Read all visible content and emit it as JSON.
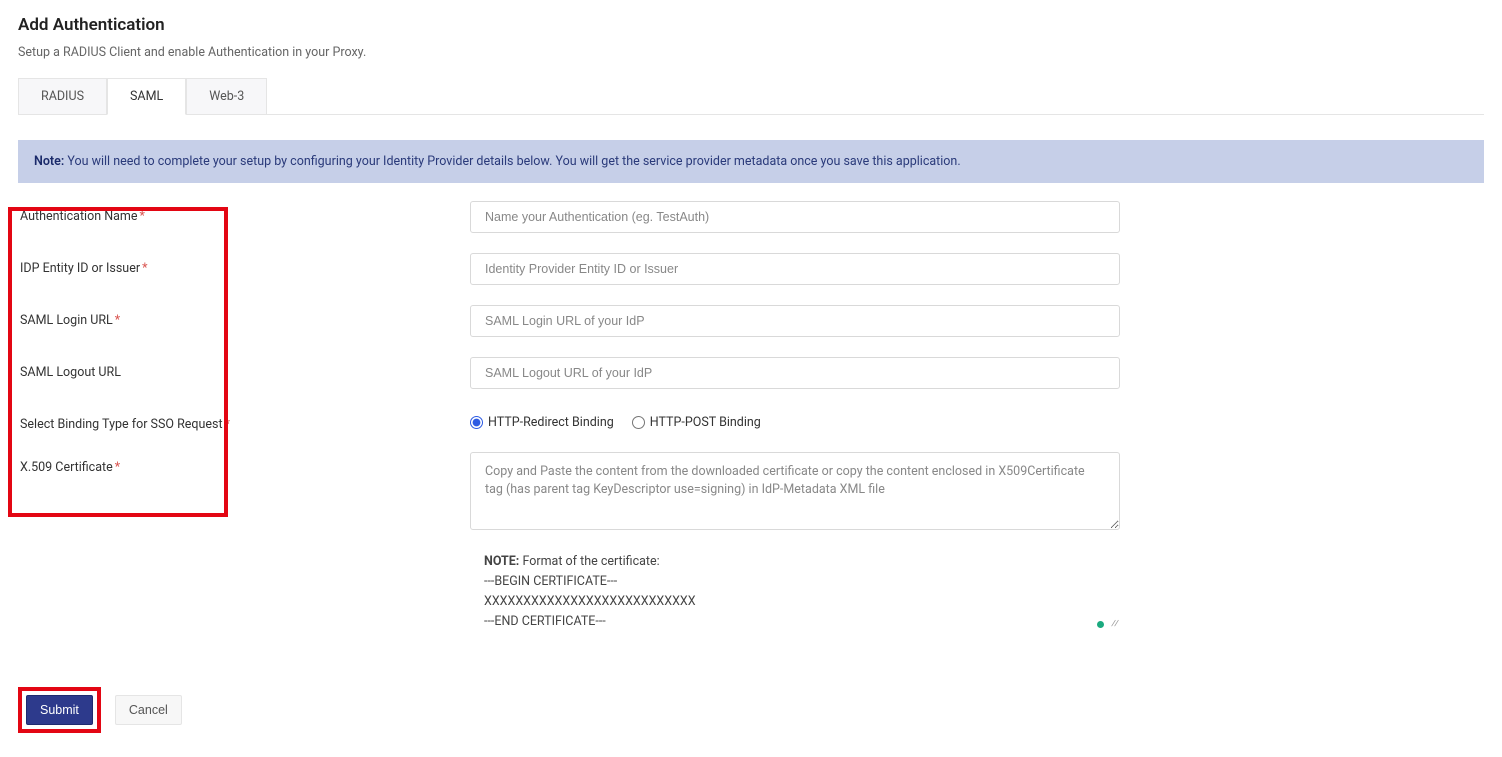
{
  "header": {
    "title": "Add Authentication",
    "subtitle": "Setup a RADIUS Client and enable Authentication in your Proxy."
  },
  "tabs": [
    {
      "label": "RADIUS",
      "active": false
    },
    {
      "label": "SAML",
      "active": true
    },
    {
      "label": "Web-3",
      "active": false
    }
  ],
  "note": {
    "label": "Note:",
    "text": " You will need to complete your setup by configuring your Identity Provider details below. You will get the service provider metadata once you save this application."
  },
  "form": {
    "auth_name": {
      "label": "Authentication Name",
      "required": true,
      "placeholder": "Name your Authentication (eg. TestAuth)"
    },
    "idp_entity": {
      "label": "IDP Entity ID or Issuer",
      "required": true,
      "placeholder": "Identity Provider Entity ID or Issuer"
    },
    "saml_login": {
      "label": "SAML Login URL",
      "required": true,
      "placeholder": "SAML Login URL of your IdP"
    },
    "saml_logout": {
      "label": "SAML Logout URL",
      "required": false,
      "placeholder": "SAML Logout URL of your IdP"
    },
    "binding": {
      "label": "Select Binding Type for SSO Request",
      "required": true,
      "options": [
        {
          "label": "HTTP-Redirect Binding",
          "checked": true
        },
        {
          "label": "HTTP-POST Binding",
          "checked": false
        }
      ]
    },
    "x509": {
      "label": "X.509 Certificate",
      "required": true,
      "placeholder": "Copy and Paste the content from the downloaded certificate or copy the content enclosed in X509Certificate tag (has parent tag KeyDescriptor use=signing) in IdP-Metadata XML file"
    }
  },
  "cert_note": {
    "bold": "NOTE:",
    "line1": " Format of the certificate:",
    "line2": "---BEGIN CERTIFICATE---",
    "line3": "XXXXXXXXXXXXXXXXXXXXXXXXXXX",
    "line4": "---END CERTIFICATE---"
  },
  "actions": {
    "submit": "Submit",
    "cancel": "Cancel"
  }
}
